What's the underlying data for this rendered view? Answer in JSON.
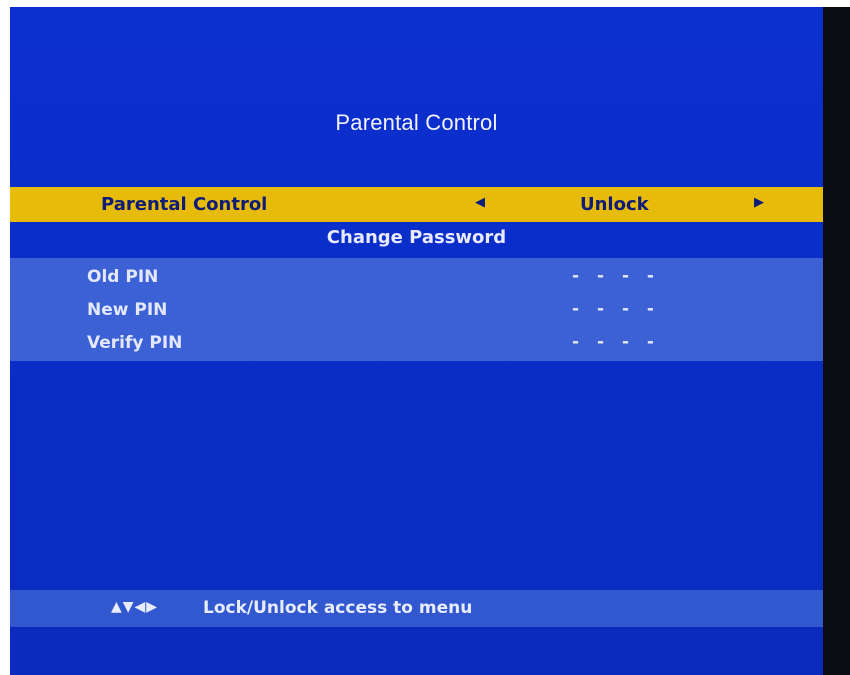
{
  "screen": {
    "title": "Parental Control"
  },
  "parental_control": {
    "label": "Parental Control",
    "left_arrow": "◀",
    "value": "Unlock",
    "right_arrow": "▶"
  },
  "change_password": {
    "header": "Change Password",
    "rows": [
      {
        "label": "Old PIN",
        "value": "- - - -"
      },
      {
        "label": "New PIN",
        "value": "- - - -"
      },
      {
        "label": "Verify PIN",
        "value": "- - - -"
      }
    ]
  },
  "hint": {
    "icons": "▲▼◀▶",
    "text": "Lock/Unlock access to menu"
  },
  "colors": {
    "background": "#0a2ec8",
    "highlight": "#e7bb0a",
    "panel": "#3b61d4"
  }
}
